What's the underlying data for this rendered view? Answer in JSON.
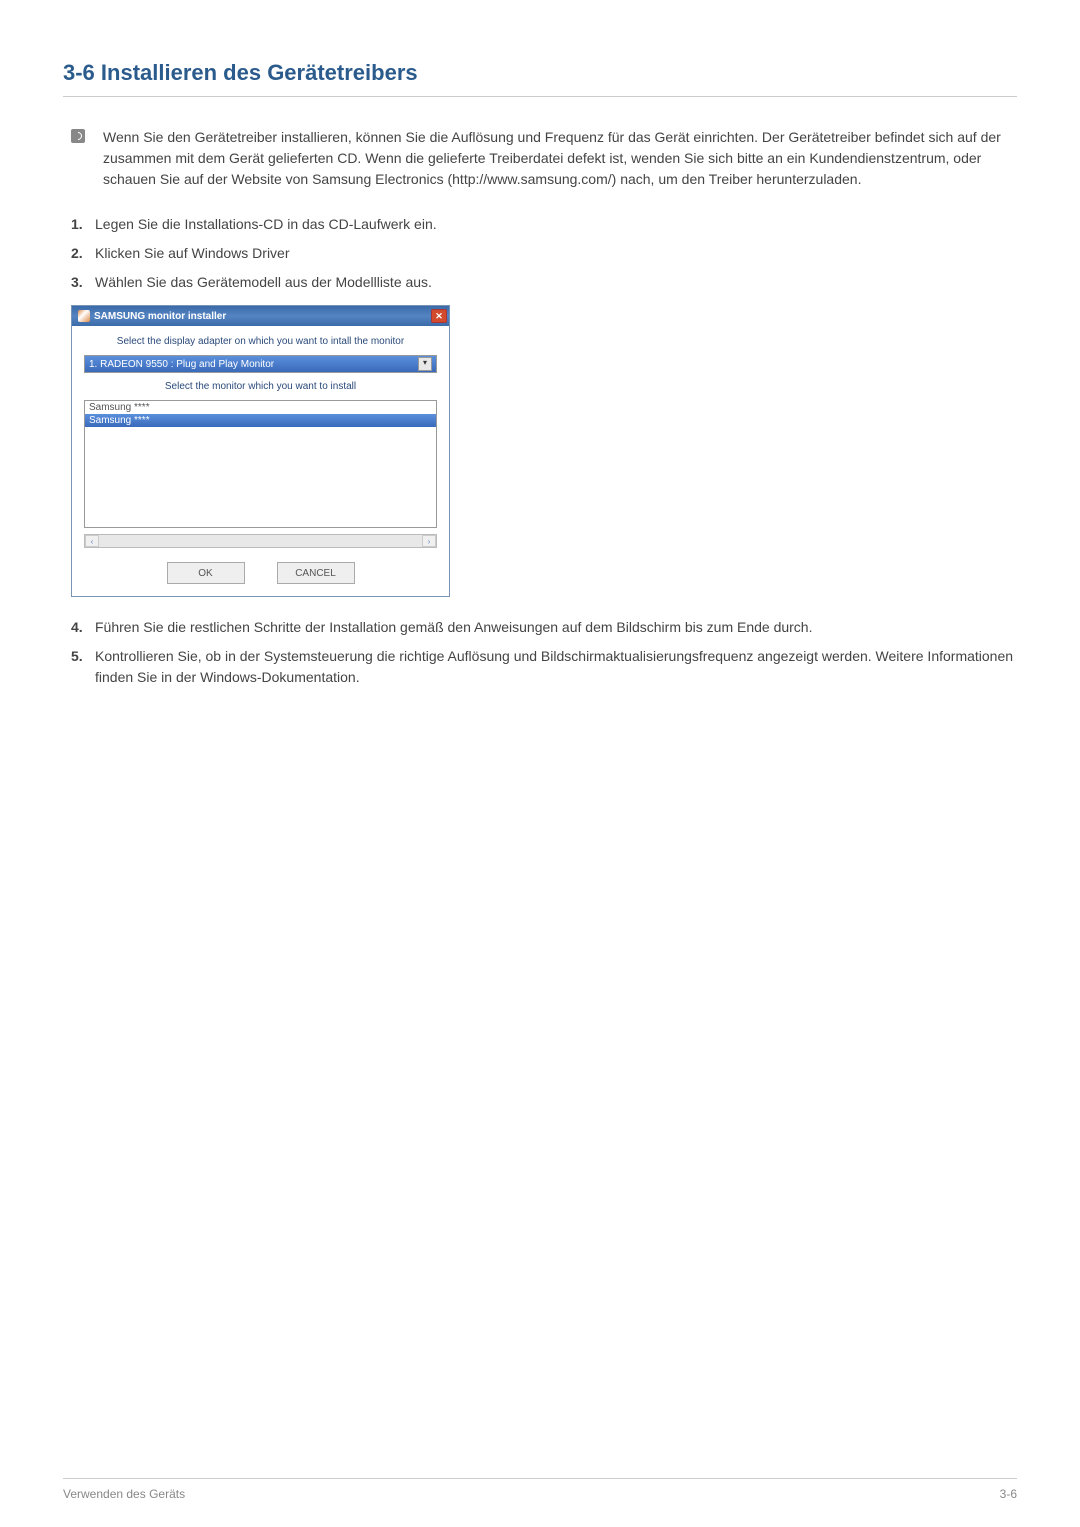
{
  "heading": "3-6    Installieren des Gerätetreibers",
  "note": "Wenn Sie den Gerätetreiber installieren, können Sie die Auflösung und Frequenz für das Gerät einrichten. Der Gerätetreiber befindet sich auf der zusammen mit dem Gerät gelieferten CD. Wenn die gelieferte Treiberdatei defekt ist, wenden Sie sich bitte an ein Kundendienstzentrum, oder schauen Sie auf der Website von Samsung Electronics (http://www.samsung.com/) nach, um den Treiber herunterzuladen.",
  "steps": {
    "s1": "Legen Sie die Installations-CD in das CD-Laufwerk ein.",
    "s2": "Klicken Sie auf Windows Driver",
    "s3": "Wählen Sie das Gerätemodell aus der Modellliste aus.",
    "s4": "Führen Sie die restlichen Schritte der Installation gemäß den Anweisungen auf dem Bildschirm bis zum Ende durch.",
    "s5": "Kontrollieren Sie, ob in der Systemsteuerung die richtige Auflösung und Bildschirmaktualisierungsfrequenz angezeigt werden. Weitere Informationen finden Sie in der Windows-Dokumentation."
  },
  "dialog": {
    "title": "SAMSUNG monitor installer",
    "label1": "Select the display adapter on which you want to intall the monitor",
    "select_value": "1. RADEON 9550 : Plug and Play Monitor",
    "label2": "Select the monitor which you want to install",
    "list": {
      "item0": "Samsung ****",
      "item1": "Samsung ****"
    },
    "ok": "OK",
    "cancel": "CANCEL"
  },
  "footer": {
    "left": "Verwenden des Geräts",
    "right": "3-6"
  }
}
